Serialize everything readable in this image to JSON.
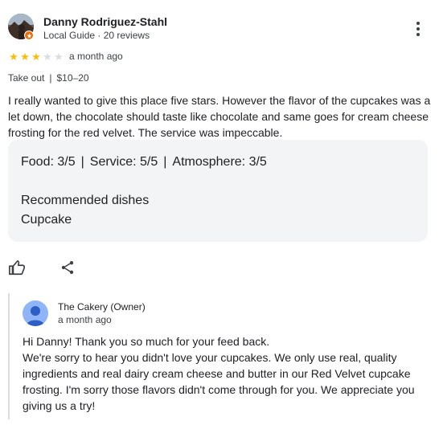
{
  "review": {
    "reviewer_name": "Danny Rodriguez-Stahl",
    "reviewer_meta": "Local Guide · 20 reviews",
    "avatar_icon": "profile-photo",
    "rating": 3,
    "rating_max": 5,
    "star_color": "#fbbc04",
    "star_empty_color": "#dadce0",
    "date": "a month ago",
    "service_type": "Take out",
    "separator": "|",
    "price": "$10–20",
    "text": "I really wanted to give this place five stars. However the flavor of the cupcakes was a let down, the chocolate should taste like chocolate and same goes for cream cheese frosting for the red velvet. The service was impeccable.",
    "ratings": {
      "food": "Food: 3/5",
      "service": "Service: 5/5",
      "atmosphere": "Atmosphere: 3/5",
      "separator": "|"
    },
    "recommended_label": "Recommended dishes",
    "recommended_value": "Cupcake",
    "actions": {
      "like_icon": "thumbs-up-icon",
      "share_icon": "share-icon",
      "more_icon": "more-vert-icon"
    }
  },
  "owner_reply": {
    "name": "The Cakery (Owner)",
    "date": "a month ago",
    "avatar_color": "#8fb4f8",
    "lines": [
      "Hi Danny! Thank you so much for your feed back.",
      "We're sorry to hear you didn't love your cupcakes. We only use real, quality ingredients and real dairy cream cheese and butter in our Red Velvet cupcake frosting. I'm sorry those flavors didn't come through for you. We appreciate you giving us a try!"
    ]
  }
}
